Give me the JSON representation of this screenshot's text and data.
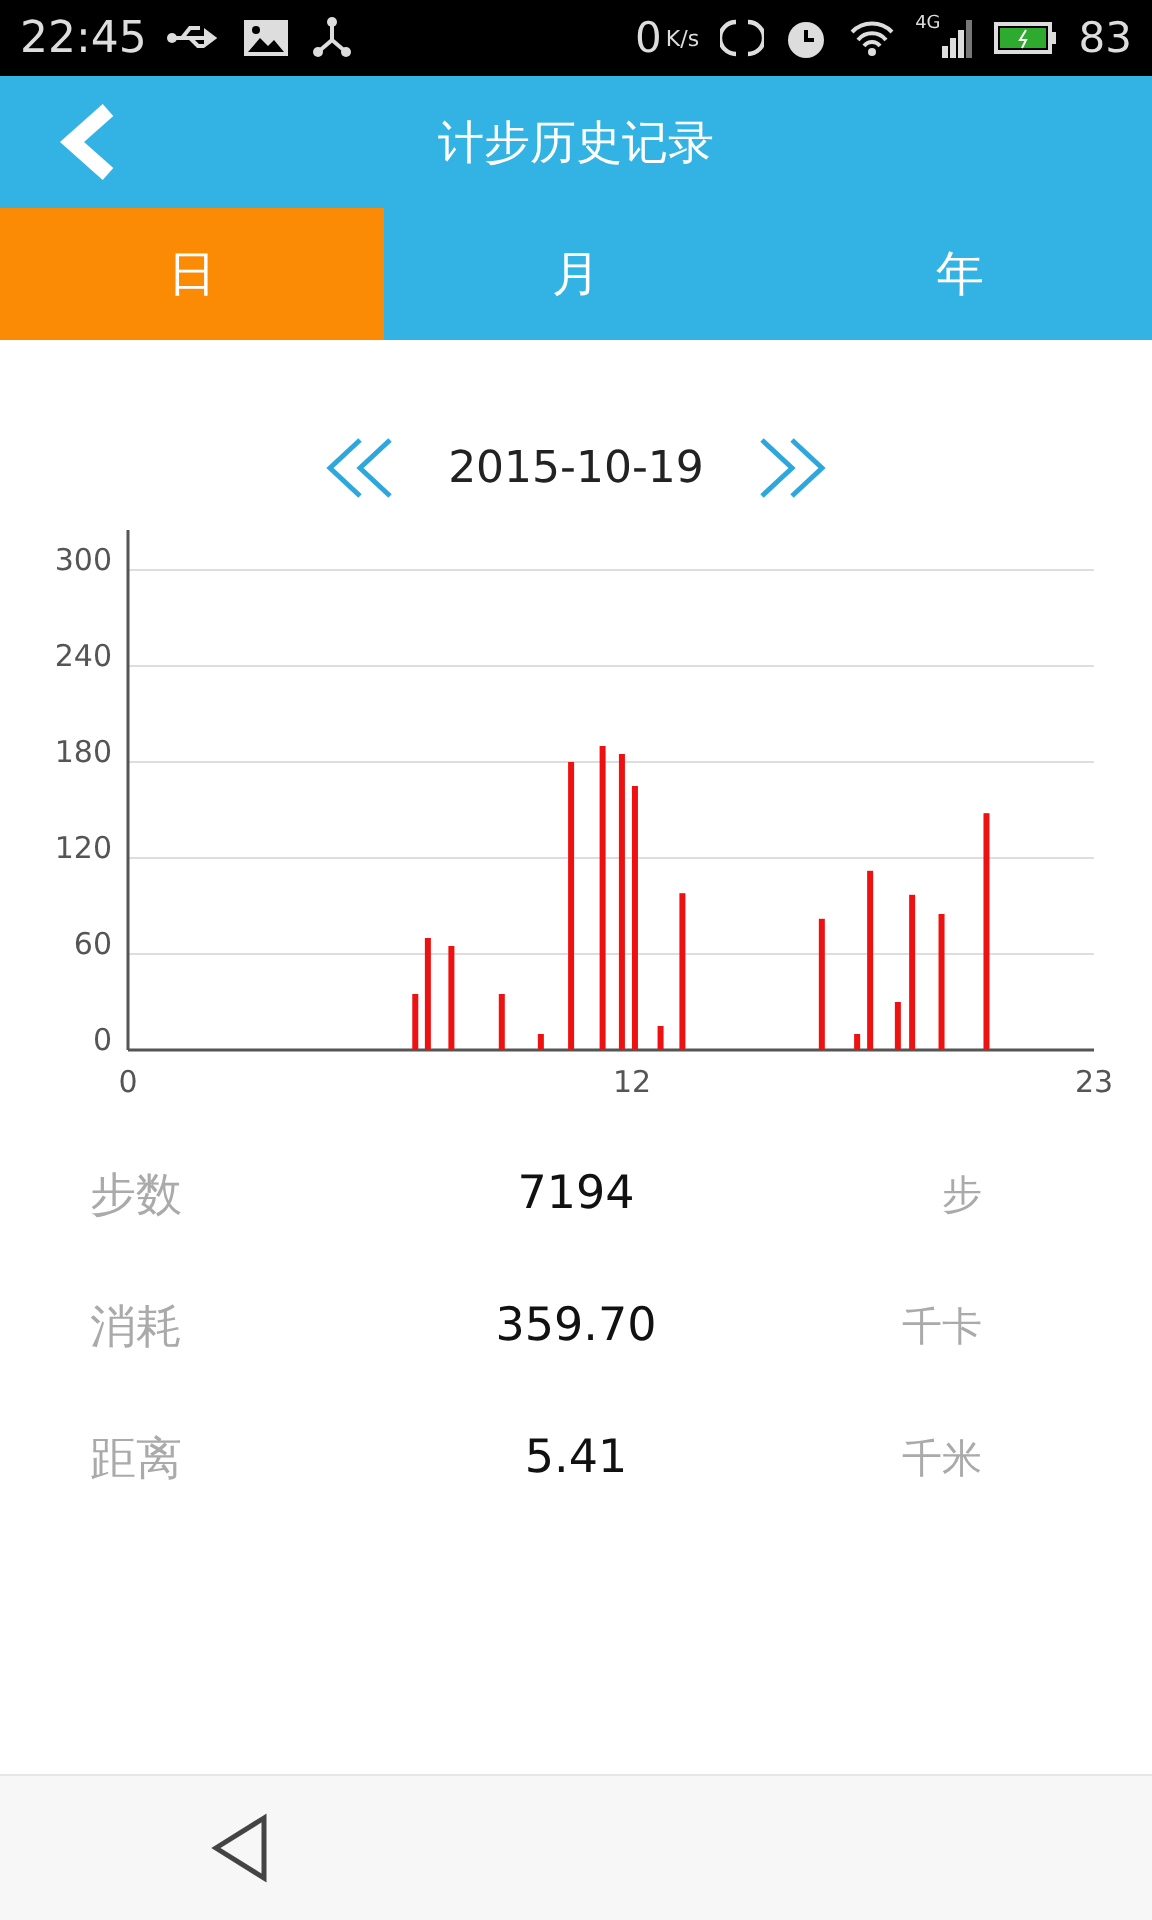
{
  "status_bar": {
    "time": "22:45",
    "speed": "0",
    "speed_unit": "K/s",
    "network": "4G",
    "battery": "83"
  },
  "header": {
    "title": "计步历史记录"
  },
  "tabs": [
    {
      "label": "日",
      "selected": true
    },
    {
      "label": "月",
      "selected": false
    },
    {
      "label": "年",
      "selected": false
    }
  ],
  "date_nav": {
    "date": "2015-10-19"
  },
  "chart_data": {
    "type": "bar",
    "xlim": [
      0,
      23
    ],
    "ylim": [
      0,
      300
    ],
    "xticks": [
      0,
      12,
      23
    ],
    "yticks": [
      0,
      60,
      120,
      180,
      240,
      300
    ],
    "grid": true,
    "x": [
      6.84,
      7.14,
      7.7,
      8.9,
      9.83,
      10.55,
      11.3,
      11.76,
      12.07,
      12.68,
      13.2,
      16.52,
      17.36,
      17.67,
      18.33,
      18.67,
      19.37,
      20.44
    ],
    "values": [
      35,
      70,
      65,
      35,
      10,
      180,
      190,
      185,
      165,
      15,
      98,
      82,
      10,
      112,
      30,
      97,
      85,
      148
    ]
  },
  "stats": [
    {
      "label": "步数",
      "value": "7194",
      "unit": "步"
    },
    {
      "label": "消耗",
      "value": "359.70",
      "unit": "千卡"
    },
    {
      "label": "距离",
      "value": "5.41",
      "unit": "千米"
    }
  ]
}
